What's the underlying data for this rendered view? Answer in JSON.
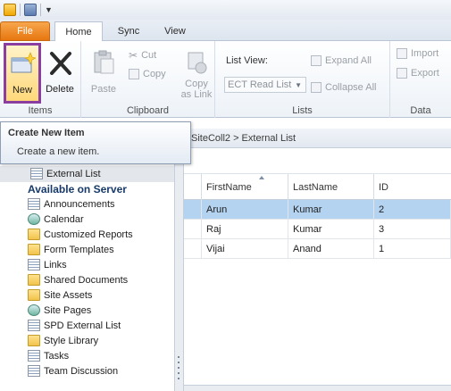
{
  "tabs": {
    "file": "File",
    "home": "Home",
    "sync": "Sync",
    "view": "View"
  },
  "ribbon": {
    "items_group": {
      "label": "Items",
      "new_label": "New",
      "delete_label": "Delete"
    },
    "clipboard_group": {
      "label": "Clipboard",
      "paste_label": "Paste",
      "cut_label": "Cut",
      "copy_label": "Copy",
      "copy_as_link_line1": "Copy",
      "copy_as_link_line2": "as Link"
    },
    "lists_group": {
      "label": "Lists",
      "list_view_label": "List View:",
      "list_view_value": "ECT Read List",
      "expand_all_label": "Expand All",
      "collapse_all_label": "Collapse All"
    },
    "data_group": {
      "label": "Data",
      "import_label": "Import",
      "export_label": "Export"
    }
  },
  "tooltip": {
    "title": "Create New Item",
    "body": "Create a new item."
  },
  "breadcrumb": "SiteColl2 > External List",
  "tree": {
    "selected_item": "External List",
    "section_title": "Available on Server",
    "items": [
      {
        "label": "Announcements",
        "icon": "list-icon"
      },
      {
        "label": "Calendar",
        "icon": "calendar-icon"
      },
      {
        "label": "Customized Reports",
        "icon": "folder-icon"
      },
      {
        "label": "Form Templates",
        "icon": "folder-icon"
      },
      {
        "label": "Links",
        "icon": "list-icon"
      },
      {
        "label": "Shared Documents",
        "icon": "folder-icon"
      },
      {
        "label": "Site Assets",
        "icon": "folder-icon"
      },
      {
        "label": "Site Pages",
        "icon": "calendar-icon"
      },
      {
        "label": "SPD External List",
        "icon": "list-icon"
      },
      {
        "label": "Style Library",
        "icon": "folder-icon"
      },
      {
        "label": "Tasks",
        "icon": "list-icon"
      },
      {
        "label": "Team Discussion",
        "icon": "list-icon"
      }
    ]
  },
  "grid": {
    "columns": [
      "FirstName",
      "LastName",
      "ID"
    ],
    "rows": [
      {
        "first": "Arun",
        "last": "Kumar",
        "id": "2",
        "selected": true
      },
      {
        "first": "Raj",
        "last": "Kumar",
        "id": "3",
        "selected": false
      },
      {
        "first": "Vijai",
        "last": "Anand",
        "id": "1",
        "selected": false
      }
    ]
  },
  "colors": {
    "file_tab": "#e6760f",
    "highlight_border": "#8a3fa0",
    "selected_row": "#b4d3f0"
  }
}
